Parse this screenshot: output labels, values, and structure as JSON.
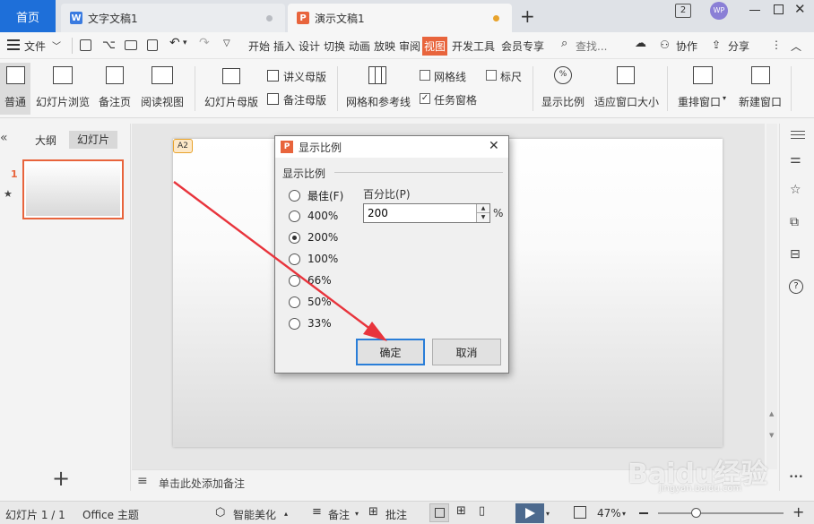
{
  "tabs": {
    "home": "首页",
    "doc": "文字文稿1",
    "ppt": "演示文稿1",
    "doc_icon": "W",
    "ppt_icon": "P"
  },
  "window": {
    "badge": "2",
    "avatar": "WP"
  },
  "menubar": {
    "file": "文件",
    "items": [
      "开始",
      "插入",
      "设计",
      "切换",
      "动画",
      "放映",
      "审阅",
      "视图",
      "开发工具",
      "会员专享"
    ],
    "search": "查找...",
    "collab": "协作",
    "share": "分享"
  },
  "ribbon": {
    "normal": "普通",
    "sorter": "幻灯片浏览",
    "notes_page": "备注页",
    "reading": "阅读视图",
    "master": "幻灯片母版",
    "handout_master": "讲义母版",
    "notes_master": "备注母版",
    "grid": "网格和参考线",
    "gridlines": "网格线",
    "ruler": "标尺",
    "taskpane": "任务窗格",
    "zoom": "显示比例",
    "fit": "适应窗口大小",
    "arrange": "重排窗口",
    "new_window": "新建窗口"
  },
  "leftpanel": {
    "outline_tab": "大纲",
    "slides_tab": "幻灯片",
    "slide_number": "1",
    "star": "★",
    "add": "+"
  },
  "slide": {
    "badge": "A2"
  },
  "notes": {
    "placeholder": "单击此处添加备注"
  },
  "dialog": {
    "title": "显示比例",
    "group": "显示比例",
    "percent_label": "百分比(P)",
    "percent_value": "200",
    "percent_unit": "%",
    "options": [
      "最佳(F)",
      "400%",
      "200%",
      "100%",
      "66%",
      "50%",
      "33%"
    ],
    "selected": "200%",
    "ok": "确定",
    "cancel": "取消",
    "close": "✕"
  },
  "statusbar": {
    "slide_info": "幻灯片 1 / 1",
    "theme": "Office 主题",
    "beautify": "智能美化",
    "notes": "备注",
    "comments": "批注",
    "zoom": "47%",
    "zoom_level": 0.47
  },
  "rightbar": {
    "more": "•••"
  },
  "watermark": {
    "text": "Baidu经验",
    "sub": "jingyan.baidu.com"
  },
  "colors": {
    "accent": "#1e6fd9",
    "ppt_orange": "#e8643c",
    "view_tab": "#e8643c",
    "arrow": "#e8343c",
    "play": "#4d6a8e",
    "dot_orange": "#e8a32c"
  }
}
